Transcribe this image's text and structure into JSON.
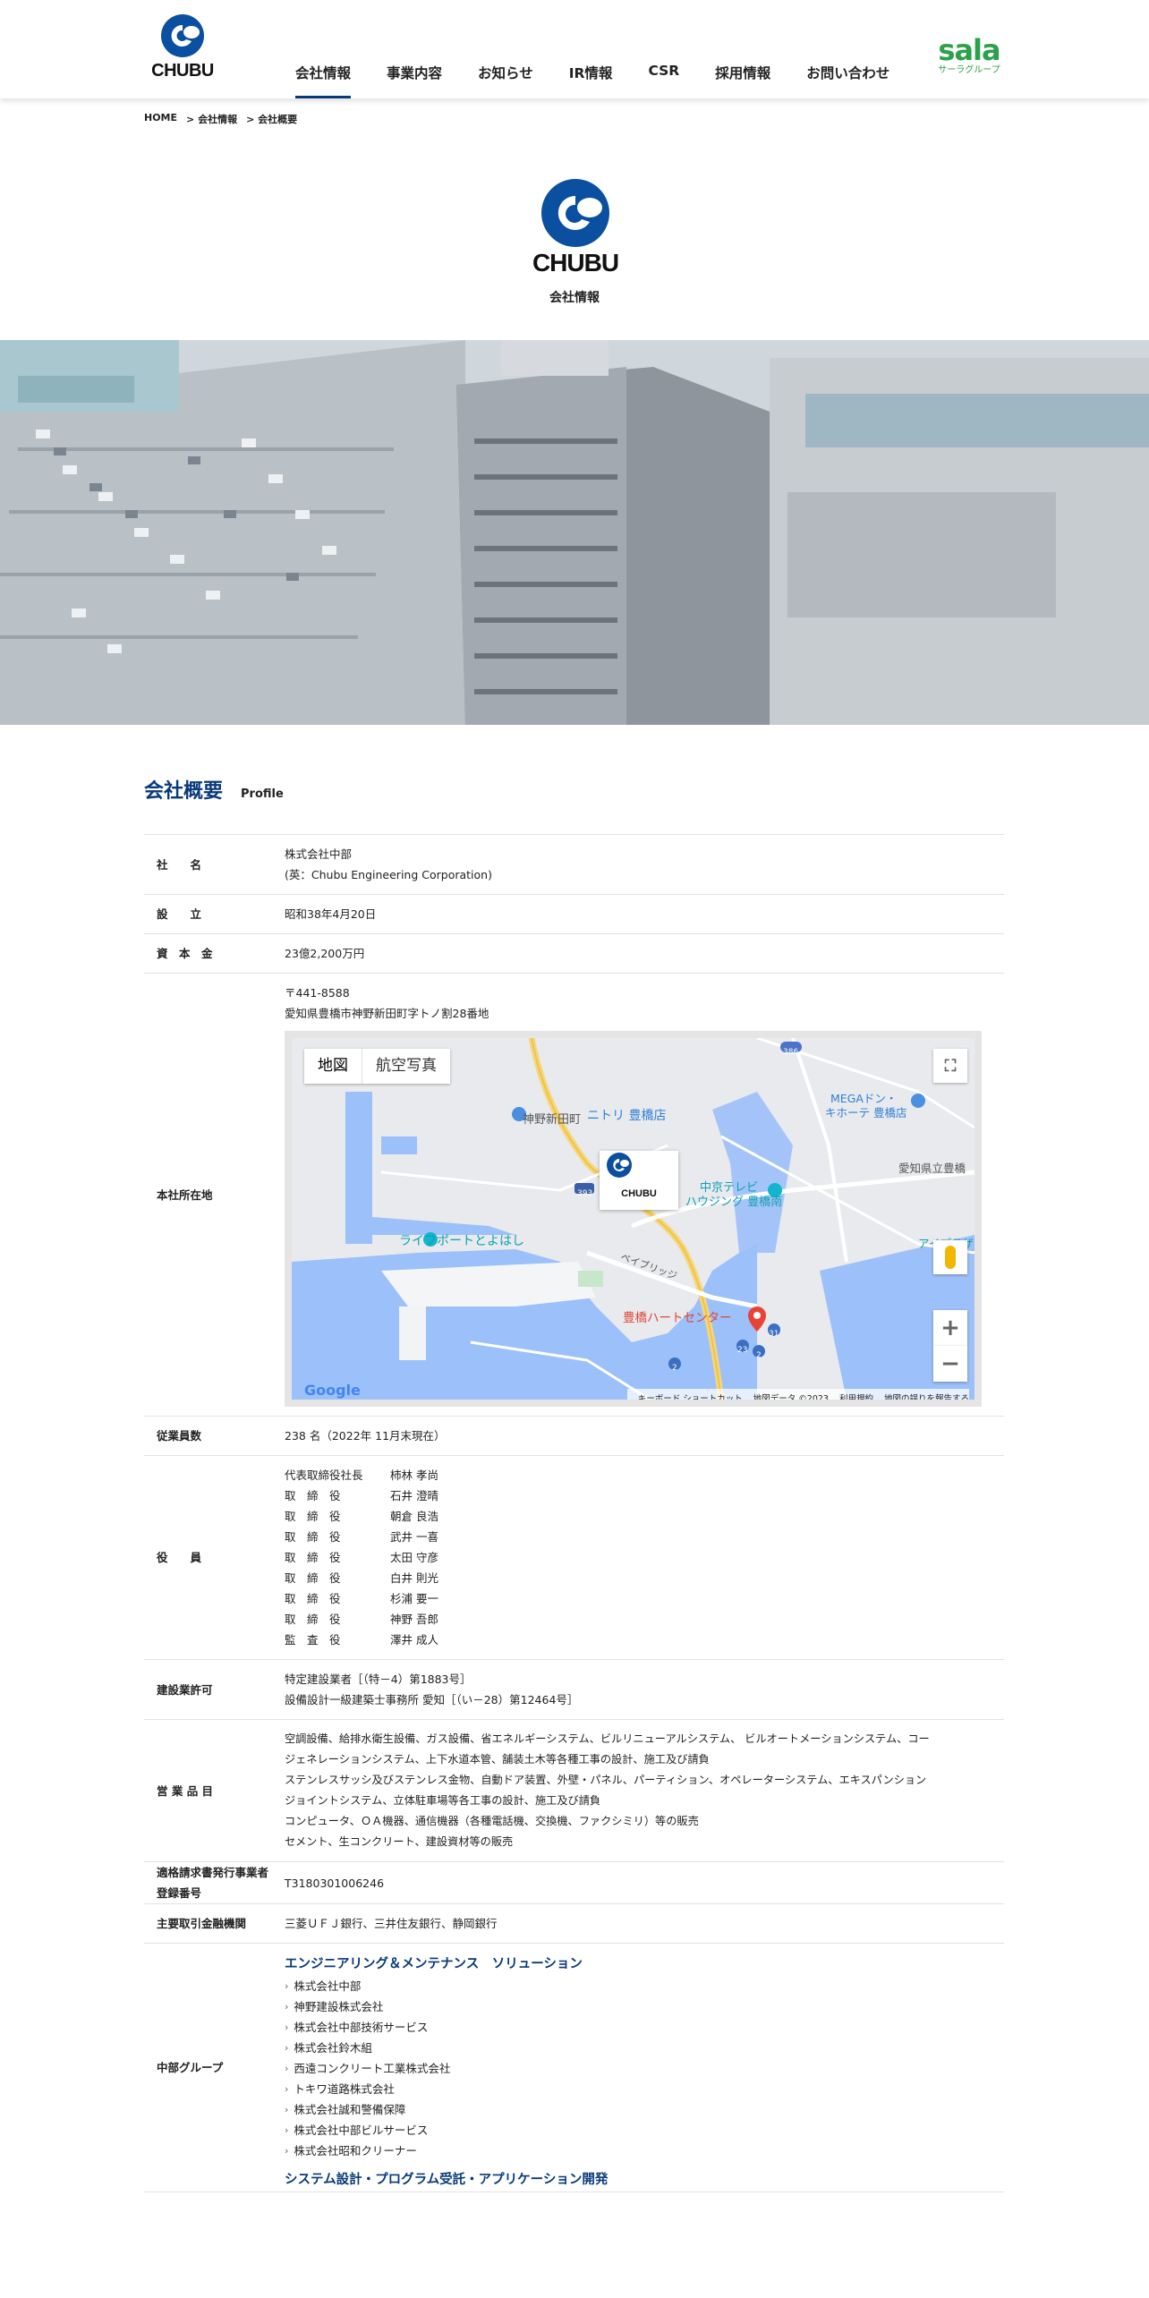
{
  "header": {
    "logo_text": "CHUBU",
    "nav": [
      "会社情報",
      "事業内容",
      "お知らせ",
      "IR情報",
      "CSR",
      "採用情報",
      "お問い合わせ"
    ],
    "group_logo": {
      "word": "sala",
      "sub": "サーラグループ"
    }
  },
  "breadcrumb": [
    "HOME",
    "> 会社情報",
    "> 会社概要"
  ],
  "hero": {
    "logo_text": "CHUBU",
    "title": "会社情報"
  },
  "section": {
    "title": "会社概要",
    "subtitle": "Profile"
  },
  "profile": {
    "company": {
      "label": "社　　名",
      "lines": [
        "株式会社中部",
        "(英：Chubu Engineering Corporation)"
      ]
    },
    "founded": {
      "label": "設　　立",
      "value": "昭和38年4月20日"
    },
    "capital": {
      "label": "資　本　金",
      "value": "23億2,200万円"
    },
    "address": {
      "label": "本社所在地",
      "lines": [
        "〒441-8588",
        "愛知県豊橋市神野新田町字トノ割28番地"
      ]
    },
    "employees": {
      "label": "従業員数",
      "value": "238 名（2022年 11月末現在）"
    },
    "officers": {
      "label": "役　　員",
      "rows": [
        {
          "role": "代表取締役社長",
          "name": "柿林 孝尚"
        },
        {
          "role": "取　締　役",
          "name": "石井 澄晴"
        },
        {
          "role": "取　締　役",
          "name": "朝倉 良浩"
        },
        {
          "role": "取　締　役",
          "name": "武井 一喜"
        },
        {
          "role": "取　締　役",
          "name": "太田 守彦"
        },
        {
          "role": "取　締　役",
          "name": "白井 則光"
        },
        {
          "role": "取　締　役",
          "name": "杉浦 要一"
        },
        {
          "role": "取　締　役",
          "name": "神野 吾郎"
        },
        {
          "role": "監　査　役",
          "name": "澤井 成人"
        }
      ]
    },
    "license": {
      "label": "建設業許可",
      "lines": [
        "特定建設業者［（特－4）第1883号］",
        "設備設計一級建築士事務所 愛知［（い－28）第12464号］"
      ]
    },
    "business": {
      "label": "営 業 品 目",
      "lines": [
        "空調設備、給排水衛生設備、ガス設備、省エネルギーシステム、ビルリニューアルシステム、 ビルオートメーションシステム、コー",
        "ジェネレーションシステム、上下水道本管、舗装土木等各種工事の設計、施工及び請負",
        "ステンレスサッシ及びステンレス金物、自動ドア装置、外壁・パネル、パーティション、オペレーターシステム、エキスパンション",
        "ジョイントシステム、立体駐車場等各工事の設計、施工及び請負",
        "コンピュータ、ＯＡ機器、通信機器（各種電話機、交換機、ファクシミリ）等の販売",
        "セメント、生コンクリート、建設資材等の販売"
      ]
    },
    "invoice": {
      "label_1": "適格請求書発行事業者",
      "label_2": "登録番号",
      "value": "T3180301006246"
    },
    "banks": {
      "label": "主要取引金融機関",
      "value": "三菱ＵＦＪ銀行、三井住友銀行、静岡銀行"
    },
    "group": {
      "label": "中部グループ",
      "heading": "エンジニアリング＆メンテナンス　ソリューション",
      "items": [
        "株式会社中部",
        "神野建設株式会社",
        "株式会社中部技術サービス",
        "株式会社鈴木組",
        "西遠コンクリート工業株式会社",
        "トキワ道路株式会社",
        "株式会社誠和警備保障",
        "株式会社中部ビルサービス",
        "株式会社昭和クリーナー"
      ],
      "heading_2": "システム設計・プログラム受託・アプリケーション開発"
    }
  },
  "map": {
    "tabs": [
      "地図",
      "航空写真"
    ],
    "labels": {
      "town": "神野新田町",
      "nitori": "ニトリ 豊橋店",
      "mega": "MEGAドン・キホーテ 豊橋店",
      "mega_1": "MEGAドン・",
      "mega_2": "キホーテ 豊橋店",
      "chukyo": "中京テレビ ハウジング 豊橋南",
      "chukyo_1": "中京テレビ",
      "chukyo_2": "ハウジング 豊橋南",
      "prefhall": "愛知県立豊橋",
      "lifeport": "ライフポートとよはし",
      "heart": "豊橋ハートセンター",
      "bypass": "ベイブリッジ",
      "iplaza": "アイプラザ",
      "r393": "393",
      "r386": "386",
      "r23": "23",
      "r31": "31",
      "r2a": "2",
      "r2b": "2"
    },
    "google": "Google",
    "footer": [
      "キーボード ショートカット",
      "地図データ ©2023",
      "利用規約",
      "地図の誤りを報告する"
    ]
  }
}
